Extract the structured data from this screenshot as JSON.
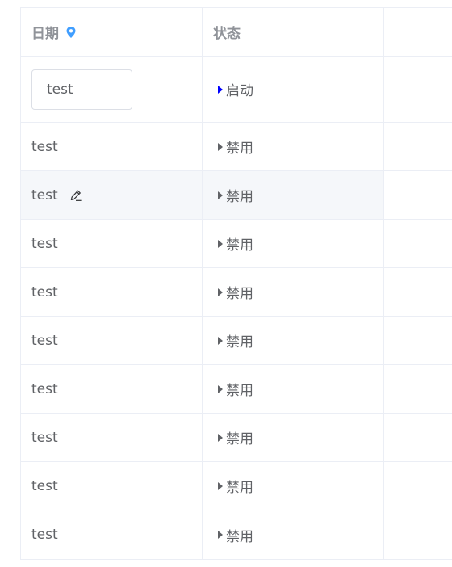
{
  "table": {
    "headers": {
      "date": "日期",
      "status": "状态"
    },
    "edit_row": {
      "input_value": "test",
      "status": "启动"
    },
    "rows": [
      {
        "date": "test",
        "status": "禁用"
      },
      {
        "date": "test",
        "status": "禁用"
      },
      {
        "date": "test",
        "status": "禁用"
      },
      {
        "date": "test",
        "status": "禁用"
      },
      {
        "date": "test",
        "status": "禁用"
      },
      {
        "date": "test",
        "status": "禁用"
      },
      {
        "date": "test",
        "status": "禁用"
      },
      {
        "date": "test",
        "status": "禁用"
      },
      {
        "date": "test",
        "status": "禁用"
      }
    ]
  },
  "colors": {
    "header_text": "#909399",
    "body_text": "#606266",
    "location_icon": "#409eff",
    "active_caret": "#0000ff",
    "hover_row": "#f5f7fa"
  },
  "icons": {
    "header_date": "location-pin-icon",
    "row_edit": "pencil-icon",
    "status_toggle": "caret-right-icon"
  }
}
